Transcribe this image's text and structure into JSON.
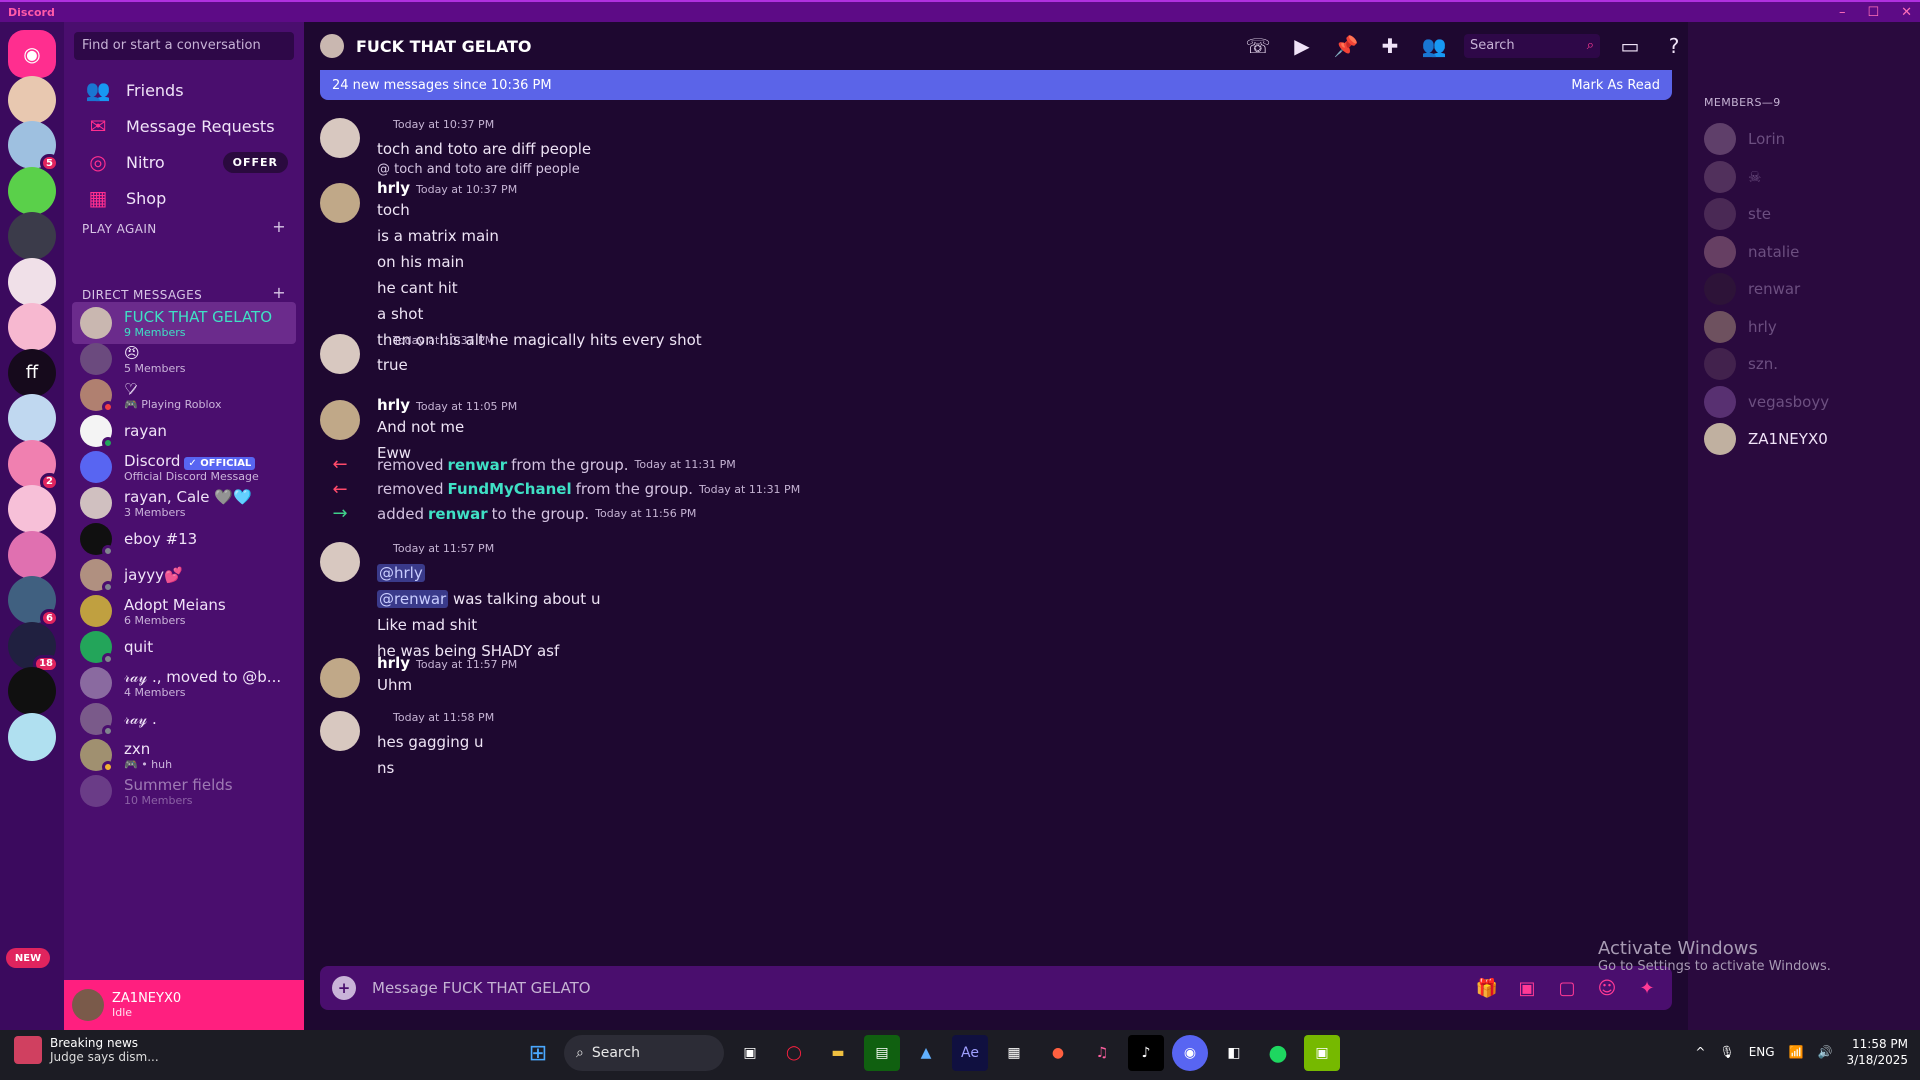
{
  "window": {
    "title": "Discord",
    "controls": [
      "–",
      "☐",
      "✕"
    ]
  },
  "guilds": {
    "items": [
      {
        "name": "home",
        "color": "#ff2e8f",
        "badge": ""
      },
      {
        "name": "guild-1",
        "color": "#e8c8b0",
        "badge": ""
      },
      {
        "name": "guild-2",
        "color": "#9ec0e0",
        "badge": "5"
      },
      {
        "name": "guild-3",
        "color": "#5ad04a",
        "badge": ""
      },
      {
        "name": "guild-4",
        "color": "#3b3b4a",
        "badge": ""
      },
      {
        "name": "guild-5",
        "color": "#f0e0e8",
        "badge": ""
      },
      {
        "name": "guild-6",
        "color": "#f7b8d0",
        "badge": ""
      },
      {
        "name": "guild-ff",
        "color": "#160a1c",
        "badge": "",
        "label": "ff"
      },
      {
        "name": "guild-8",
        "color": "#c0d8f0",
        "badge": ""
      },
      {
        "name": "guild-9",
        "color": "#f080b0",
        "badge": "2"
      },
      {
        "name": "guild-10",
        "color": "#f7c0d8",
        "badge": ""
      },
      {
        "name": "guild-11",
        "color": "#e070b0",
        "badge": ""
      },
      {
        "name": "guild-12",
        "color": "#406080",
        "badge": "6"
      },
      {
        "name": "guild-13",
        "color": "#202040",
        "badge": "18"
      },
      {
        "name": "guild-14",
        "color": "#101010",
        "badge": ""
      },
      {
        "name": "guild-15",
        "color": "#b0e0f0",
        "badge": ""
      }
    ],
    "new_label": "NEW"
  },
  "dm": {
    "search_placeholder": "Find or start a conversation",
    "nav": [
      {
        "icon": "friends-icon",
        "glyph": "👥",
        "label": "Friends"
      },
      {
        "icon": "mail-icon",
        "glyph": "✉",
        "label": "Message Requests"
      },
      {
        "icon": "nitro-icon",
        "glyph": "◎",
        "label": "Nitro",
        "tag": "OFFER"
      },
      {
        "icon": "shop-icon",
        "glyph": "▦",
        "label": "Shop"
      }
    ],
    "play_again": "PLAY AGAIN",
    "direct_messages": "DIRECT MESSAGES",
    "plus": "+",
    "list": [
      {
        "name": "FUCK THAT GELATO",
        "sub": "9 Members",
        "color": "#c9b7b0",
        "active": true
      },
      {
        "name": "😠",
        "sub": "5 Members",
        "color": "#6b4a7e"
      },
      {
        "name": "♡̷",
        "sub": "🎮 Playing Roblox",
        "color": "#b08070",
        "status": "#f23f43"
      },
      {
        "name": "rayan",
        "sub": "",
        "color": "#f4f4f4",
        "status": "#23a55a"
      },
      {
        "name": "Discord",
        "sub": "Official Discord Message",
        "color": "#5865f2",
        "tag": "✓ OFFICIAL"
      },
      {
        "name": "rayan, Cale 🩶🩵",
        "sub": "3 Members",
        "color": "#d0c0c0"
      },
      {
        "name": "eboy #13",
        "sub": "",
        "color": "#101010",
        "status": "#80848e"
      },
      {
        "name": "jayyy💕",
        "sub": "",
        "color": "#b09080",
        "status": "#80848e"
      },
      {
        "name": "Adopt Meians",
        "sub": "6 Members",
        "color": "#c0a040"
      },
      {
        "name": "quit",
        "sub": "",
        "color": "#23a55a",
        "status": "#80848e"
      },
      {
        "name": "𝓇𝒶𝓎 ., moved to @b...",
        "sub": "4 Members",
        "color": "#8a6aa0"
      },
      {
        "name": "𝓇𝒶𝓎 .",
        "sub": "",
        "color": "#7a5a8a",
        "status": "#80848e"
      },
      {
        "name": "zxn",
        "sub": "🎮 • huh",
        "color": "#a09070",
        "status": "#f0b232"
      },
      {
        "name": "Summer fields",
        "sub": "10 Members",
        "color": "#8a6aa0"
      }
    ],
    "user": {
      "name": "ZA1NEYX0",
      "status": "Idle"
    }
  },
  "channel": {
    "name": "FUCK THAT GELATO",
    "search_placeholder": "Search",
    "new_messages": "24 new messages since 10:36 PM",
    "mark_read": "Mark As Read",
    "composer_placeholder": "Message FUCK THAT GELATO"
  },
  "messages": [
    {
      "author": "",
      "time": "Today at 10:37 PM",
      "lines": [
        "toch and toto are diff people"
      ],
      "av": "#d8c8c0"
    },
    {
      "reply": "@  toch and toto are diff people",
      "author": "hrly",
      "time": "Today at 10:37 PM",
      "lines": [
        "toch",
        "is a matrix main",
        "on his main",
        "he cant hit",
        "a shot",
        "then on his alt he magically hits every shot"
      ],
      "av": "#c0a888"
    },
    {
      "author": "",
      "time": "Today at 10:37 PM",
      "lines": [
        "true"
      ],
      "av": "#d8c8c0"
    },
    {
      "author": "hrly",
      "time": "Today at 11:05 PM",
      "lines": [
        "And not me",
        "Eww"
      ],
      "av": "#c0a888"
    },
    {
      "author": "",
      "time": "Today at 11:57 PM",
      "lines": [
        "@hrly",
        "@renwar was talking about u",
        "Like mad shit",
        "he was being SHADY asf"
      ],
      "av": "#d8c8c0"
    },
    {
      "author": "hrly",
      "time": "Today at 11:57 PM",
      "lines": [
        "Uhm"
      ],
      "av": "#c0a888"
    },
    {
      "author": "",
      "time": "Today at 11:58 PM",
      "lines": [
        "hes gagging u",
        "ns"
      ],
      "av": "#d8c8c0"
    }
  ],
  "system": [
    {
      "arrow": "←",
      "color": "#ff4a6a",
      "pre": "removed",
      "who": "renwar",
      "post": "from the group.",
      "time": "Today at 11:31 PM"
    },
    {
      "arrow": "←",
      "color": "#ff4a6a",
      "pre": "removed",
      "who": "FundMyChanel",
      "post": "from the group.",
      "time": "Today at 11:31 PM"
    },
    {
      "arrow": "→",
      "color": "#3fd08a",
      "pre": "added",
      "who": "renwar",
      "post": "to the group.",
      "time": "Today at 11:56 PM"
    }
  ],
  "members": {
    "header": "MEMBERS—9",
    "list": [
      {
        "name": "Lorin",
        "color": "#a080a0"
      },
      {
        "name": "☠",
        "color": "#806080"
      },
      {
        "name": "ste",
        "color": "#705070"
      },
      {
        "name": "natalie",
        "color": "#b08090"
      },
      {
        "name": "renwar",
        "color": "#302030"
      },
      {
        "name": "hrly",
        "color": "#c0a888"
      },
      {
        "name": "szn.",
        "color": "#604060"
      },
      {
        "name": "vegasboyy",
        "color": "#9060b0"
      },
      {
        "name": "ZA1NEYX0",
        "color": "#c0b0a0",
        "online": true
      }
    ]
  },
  "watermark": {
    "title": "Activate Windows",
    "sub": "Go to Settings to activate Windows."
  },
  "taskbar": {
    "news_title": "Breaking news",
    "news_sub": "Judge says dism...",
    "search": "Search",
    "lang": "ENG",
    "time": "11:58 PM",
    "date": "3/18/2025"
  }
}
